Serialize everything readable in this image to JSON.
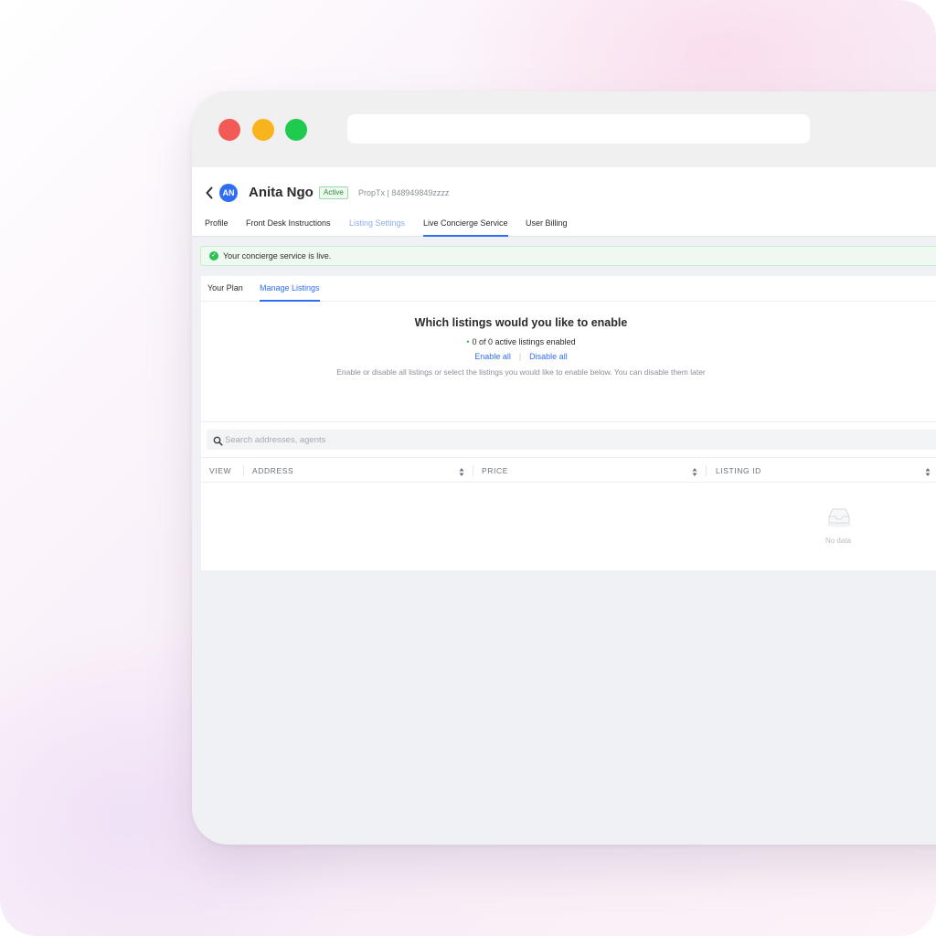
{
  "user": {
    "initials": "AN",
    "name": "Anita Ngo",
    "status": "Active",
    "brokerage": "PropTx | 848949849zzzz"
  },
  "tabs": [
    {
      "label": "Profile",
      "state": "default"
    },
    {
      "label": "Front Desk Instructions",
      "state": "default"
    },
    {
      "label": "Listing Settings",
      "state": "muted"
    },
    {
      "label": "Live Concierge Service",
      "state": "active"
    },
    {
      "label": "User Billing",
      "state": "default"
    }
  ],
  "alert": {
    "text": "Your concierge service is live."
  },
  "subtabs": [
    {
      "label": "Your Plan",
      "state": "default"
    },
    {
      "label": "Manage Listings",
      "state": "active"
    }
  ],
  "manage": {
    "title": "Which listings would you like to enable",
    "count_text": "0 of 0 active listings enabled",
    "enable_all": "Enable all",
    "separator": "|",
    "disable_all": "Disable all",
    "helper": "Enable or disable all listings or select the listings you would like to enable below. You can disable them later"
  },
  "search": {
    "placeholder": "Search addresses, agents"
  },
  "table": {
    "columns": [
      "VIEW",
      "ADDRESS",
      "PRICE",
      "LISTING ID"
    ],
    "rows": [],
    "empty_text": "No data"
  },
  "colors": {
    "accent": "#2f6ef2",
    "success": "#2fbf55",
    "traffic_red": "#f35a55",
    "traffic_yellow": "#f8b41c",
    "traffic_green": "#1fcb4f"
  }
}
